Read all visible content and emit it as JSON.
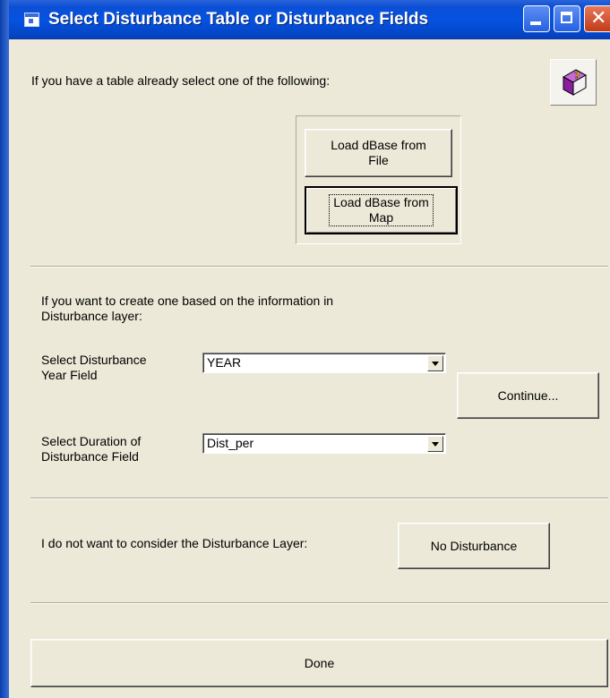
{
  "window": {
    "title": "Select Disturbance Table or Disturbance Fields"
  },
  "section_table": {
    "prompt": "If you have a table already select one of the following:",
    "load_file_line1": "Load dBase from",
    "load_file_line2": "File",
    "load_map_line1": "Load dBase from",
    "load_map_line2": "Map"
  },
  "section_create": {
    "prompt_line1": "If you want to create one based on the information in",
    "prompt_line2": "Disturbance layer:",
    "year_label_line1": "Select Disturbance",
    "year_label_line2": "Year Field",
    "year_value": "YEAR",
    "duration_label_line1": "Select Duration of",
    "duration_label_line2": "Disturbance Field",
    "duration_value": "Dist_per",
    "continue_label": "Continue..."
  },
  "section_none": {
    "prompt": "I do not want to consider the Disturbance Layer:",
    "button_label": "No Disturbance"
  },
  "footer": {
    "done_label": "Done"
  },
  "icons": {
    "help": "help-book-icon",
    "system": "window-system-icon"
  },
  "colors": {
    "titlebar": "#0552e0",
    "face": "#ece9d8",
    "close": "#c23b18"
  }
}
